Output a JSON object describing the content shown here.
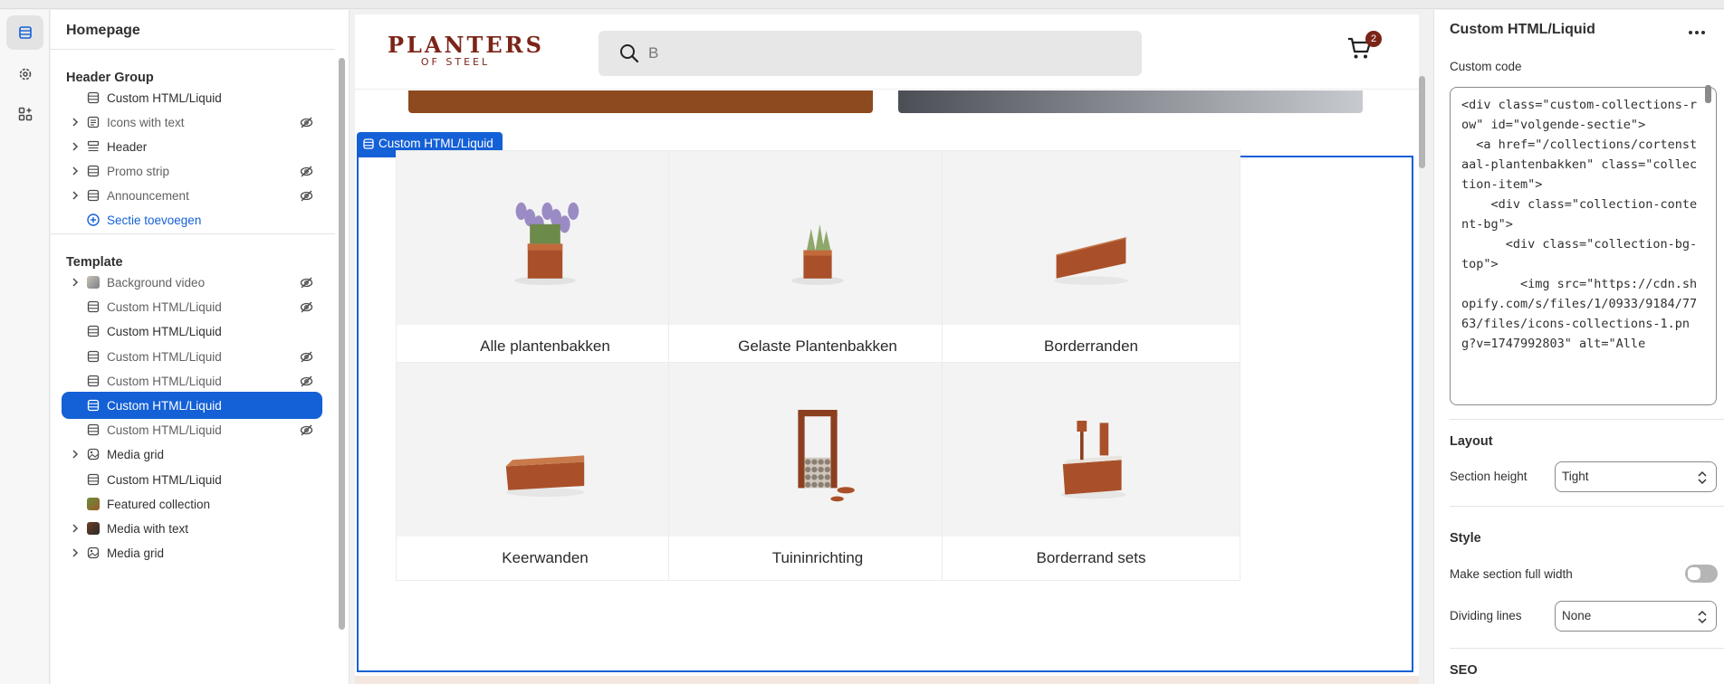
{
  "sidebar": {
    "title": "Homepage",
    "header_group": {
      "title": "Header Group",
      "items": [
        {
          "label": "Custom HTML/Liquid",
          "icon": "section-icon",
          "expandable": false,
          "hidden": false
        },
        {
          "label": "Icons with text",
          "icon": "list-icon",
          "expandable": true,
          "hidden": true
        },
        {
          "label": "Header",
          "icon": "header-icon",
          "expandable": true,
          "hidden": false
        },
        {
          "label": "Promo strip",
          "icon": "section-icon",
          "expandable": true,
          "hidden": true
        },
        {
          "label": "Announcement",
          "icon": "section-icon",
          "expandable": true,
          "hidden": true
        }
      ],
      "add_label": "Sectie toevoegen"
    },
    "template": {
      "title": "Template",
      "items": [
        {
          "label": "Background video",
          "icon": "video-thumbnail",
          "expandable": true,
          "hidden": true,
          "selected": false
        },
        {
          "label": "Custom HTML/Liquid",
          "icon": "section-icon",
          "expandable": false,
          "hidden": true,
          "selected": false
        },
        {
          "label": "Custom HTML/Liquid",
          "icon": "section-icon",
          "expandable": false,
          "hidden": false,
          "selected": false
        },
        {
          "label": "Custom HTML/Liquid",
          "icon": "section-icon",
          "expandable": false,
          "hidden": true,
          "selected": false
        },
        {
          "label": "Custom HTML/Liquid",
          "icon": "section-icon",
          "expandable": false,
          "hidden": true,
          "selected": false
        },
        {
          "label": "Custom HTML/Liquid",
          "icon": "section-icon",
          "expandable": false,
          "hidden": false,
          "selected": true
        },
        {
          "label": "Custom HTML/Liquid",
          "icon": "section-icon",
          "expandable": false,
          "hidden": true,
          "selected": false
        },
        {
          "label": "Media grid",
          "icon": "media-grid-icon",
          "expandable": true,
          "hidden": false,
          "selected": false
        },
        {
          "label": "Custom HTML/Liquid",
          "icon": "section-icon",
          "expandable": false,
          "hidden": false,
          "selected": false
        },
        {
          "label": "Featured collection",
          "icon": "collection-thumbnail",
          "expandable": false,
          "hidden": false,
          "selected": false
        },
        {
          "label": "Media with text",
          "icon": "media-thumbnail",
          "expandable": true,
          "hidden": false,
          "selected": false
        },
        {
          "label": "Media grid",
          "icon": "media-grid-icon",
          "expandable": true,
          "hidden": false,
          "selected": false
        }
      ]
    }
  },
  "preview": {
    "logo_line1": "PLANTERS",
    "logo_line2": "OF STEEL",
    "search_value": "B",
    "cart_count": "2",
    "section_tag": "Custom HTML/Liquid",
    "collections": [
      {
        "label": "Alle plantenbakken",
        "image": "planter-with-lavender"
      },
      {
        "label": "Gelaste Plantenbakken",
        "image": "planter-with-grass"
      },
      {
        "label": "Borderranden",
        "image": "border-edge"
      },
      {
        "label": "Keerwanden",
        "image": "retaining-wall"
      },
      {
        "label": "Tuininrichting",
        "image": "log-store"
      },
      {
        "label": "Borderrand sets",
        "image": "border-set"
      }
    ],
    "accent_color": "#1460d6",
    "brand_color": "#7b2418"
  },
  "settings": {
    "title": "Custom HTML/Liquid",
    "custom_code_label": "Custom code",
    "custom_code": "<div class=\"custom-collections-row\" id=\"volgende-sectie\">\n  <a href=\"/collections/cortenstaal-plantenbakken\" class=\"collection-item\">\n    <div class=\"collection-content-bg\">\n      <div class=\"collection-bg-top\">\n        <img src=\"https://cdn.shopify.com/s/files/1/0933/9184/7763/files/icons-collections-1.png?v=1747992803\" alt=\"Alle",
    "layout_heading": "Layout",
    "section_height_label": "Section height",
    "section_height_value": "Tight",
    "style_heading": "Style",
    "full_width_label": "Make section full width",
    "full_width_on": false,
    "dividing_lines_label": "Dividing lines",
    "dividing_lines_value": "None",
    "seo_heading": "SEO"
  }
}
